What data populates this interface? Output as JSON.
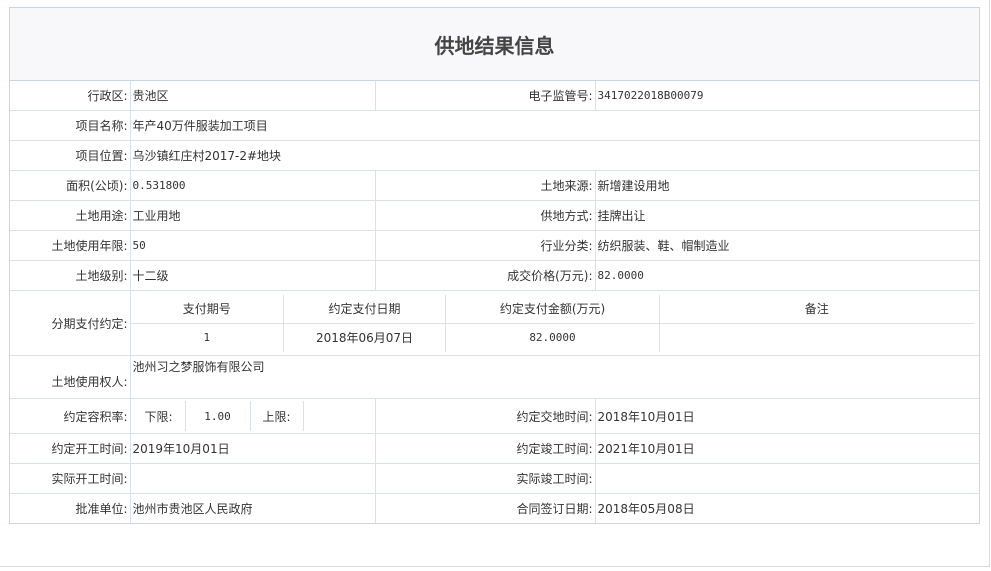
{
  "title": "供地结果信息",
  "rows": {
    "district": {
      "label": "行政区:",
      "value": "贵池区"
    },
    "supervision_no": {
      "label": "电子监管号:",
      "value": "3417022018B00079"
    },
    "project_name": {
      "label": "项目名称:",
      "value": "年产40万件服装加工项目"
    },
    "project_location": {
      "label": "项目位置:",
      "value": "乌沙镇红庄村2017-2#地块"
    },
    "area": {
      "label": "面积(公顷):",
      "value": "0.531800"
    },
    "land_source": {
      "label": "土地来源:",
      "value": "新增建设用地"
    },
    "land_use": {
      "label": "土地用途:",
      "value": "工业用地"
    },
    "supply_method": {
      "label": "供地方式:",
      "value": "挂牌出让"
    },
    "use_years": {
      "label": "土地使用年限:",
      "value": "50"
    },
    "industry": {
      "label": "行业分类:",
      "value": "纺织服装、鞋、帽制造业"
    },
    "land_grade": {
      "label": "土地级别:",
      "value": "十二级"
    },
    "price": {
      "label": "成交价格(万元):",
      "value": "82.0000"
    },
    "installment": {
      "label": "分期支付约定:",
      "headers": [
        "支付期号",
        "约定支付日期",
        "约定支付金额(万元)",
        "备注"
      ],
      "rows": [
        [
          "1",
          "2018年06月07日",
          "82.0000",
          ""
        ]
      ]
    },
    "land_user": {
      "label": "土地使用权人:",
      "value": "池州习之梦服饰有限公司"
    },
    "plot_ratio": {
      "label": "约定容积率:",
      "lower_label": "下限:",
      "lower_value": "1.00",
      "upper_label": "上限:",
      "upper_value": ""
    },
    "delivery_time": {
      "label": "约定交地时间:",
      "value": "2018年10月01日"
    },
    "start_time": {
      "label": "约定开工时间:",
      "value": "2019年10月01日"
    },
    "finish_time": {
      "label": "约定竣工时间:",
      "value": "2021年10月01日"
    },
    "actual_start": {
      "label": "实际开工时间:",
      "value": ""
    },
    "actual_finish": {
      "label": "实际竣工时间:",
      "value": ""
    },
    "approval_unit": {
      "label": "批准单位:",
      "value": "池州市贵池区人民政府"
    },
    "contract_date": {
      "label": "合同签订日期:",
      "value": "2018年05月08日"
    }
  }
}
